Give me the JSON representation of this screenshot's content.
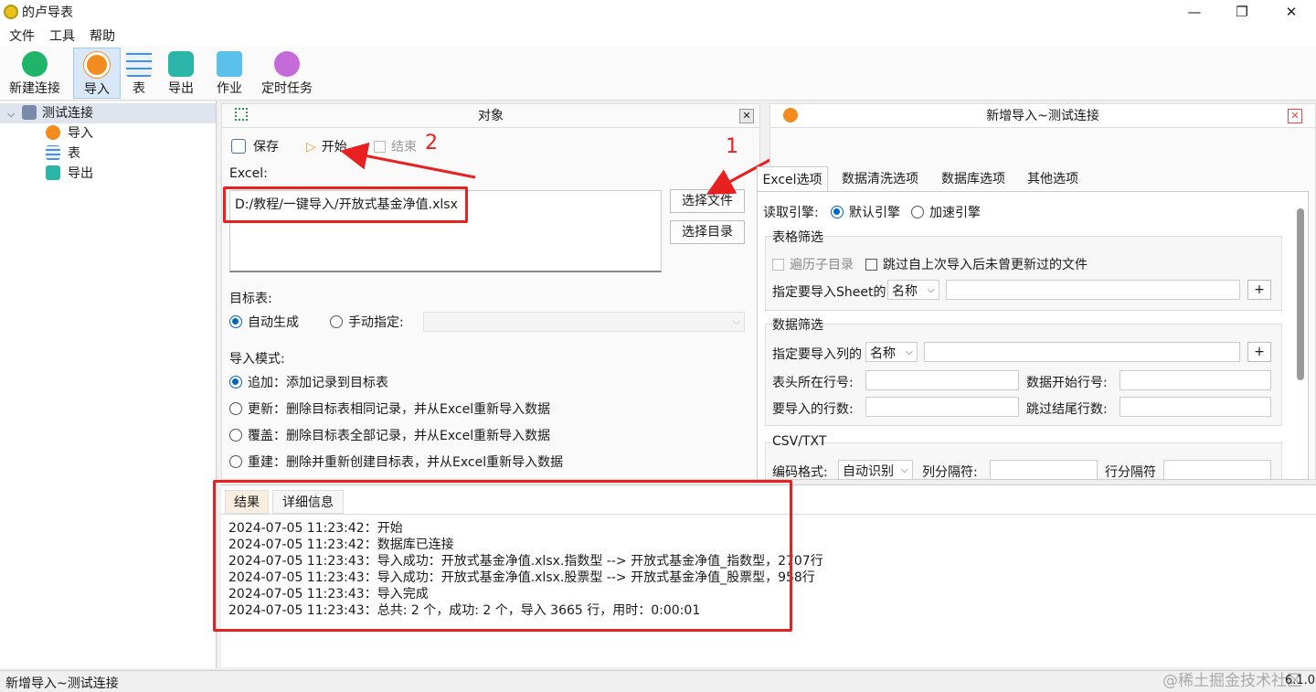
{
  "window": {
    "title": "的卢导表",
    "min": "—",
    "max": "❐",
    "close": "✕"
  },
  "menu": [
    "文件",
    "工具",
    "帮助"
  ],
  "toolbar": {
    "new_connection": "新建连接",
    "import": "导入",
    "table": "表",
    "export": "导出",
    "job": "作业",
    "scheduled": "定时任务"
  },
  "tree": {
    "connection": "测试连接",
    "children": [
      "导入",
      "表",
      "导出"
    ]
  },
  "left_pane": {
    "title": "对象",
    "save": "保存",
    "start": "开始",
    "end": "结束",
    "excel_label": "Excel:",
    "excel_path": "D:/教程/一键导入/开放式基金净值.xlsx",
    "choose_file": "选择文件",
    "choose_dir": "选择目录",
    "target_label": "目标表:",
    "auto_gen": "自动生成",
    "manual": "手动指定:",
    "mode_label": "导入模式:",
    "modes": [
      "追加：添加记录到目标表",
      "更新：删除目标表相同记录，并从Excel重新导入数据",
      "覆盖：删除目标表全部记录，并从Excel重新导入数据",
      "重建：删除并重新创建目标表，并从Excel重新导入数据"
    ]
  },
  "annotations": {
    "one": "1",
    "two": "2"
  },
  "right_pane": {
    "title": "新增导入~测试连接",
    "tabs": [
      "Excel选项",
      "数据清洗选项",
      "数据库选项",
      "其他选项"
    ],
    "engine_label": "读取引擎:",
    "engine_default": "默认引擎",
    "engine_fast": "加速引擎",
    "table_filter": "表格筛选",
    "traverse": "遍历子目录",
    "skip": "跳过自上次导入后未曾更新过的文件",
    "sheet_label": "指定要导入Sheet的",
    "sheet_sel": "名称",
    "plus": "+",
    "data_filter": "数据筛选",
    "col_label": "指定要导入列的",
    "col_sel": "名称",
    "header_row": "表头所在行号:",
    "data_start": "数据开始行号:",
    "rows": "要导入的行数:",
    "skip_tail": "跳过结尾行数:",
    "csv": "CSV/TXT",
    "encoding": "编码格式:",
    "encoding_val": "自动识别",
    "col_sep": "列分隔符:",
    "row_sep": "行分隔符"
  },
  "result": {
    "tabs": [
      "结果",
      "详细信息"
    ],
    "lines": [
      "2024-07-05 11:23:42：开始",
      "2024-07-05 11:23:42：数据库已连接",
      "2024-07-05 11:23:43：导入成功：开放式基金净值.xlsx.指数型 --> 开放式基金净值_指数型，2707行",
      "2024-07-05 11:23:43：导入成功：开放式基金净值.xlsx.股票型 --> 开放式基金净值_股票型，958行",
      "2024-07-05 11:23:43：导入完成",
      "2024-07-05 11:23:43：总共: 2 个，成功: 2 个，导入 3665 行，用时：0:00:01"
    ]
  },
  "status": {
    "text": "新增导入~测试连接",
    "version": "6.1.0",
    "watermark": "@稀土掘金技术社区"
  }
}
